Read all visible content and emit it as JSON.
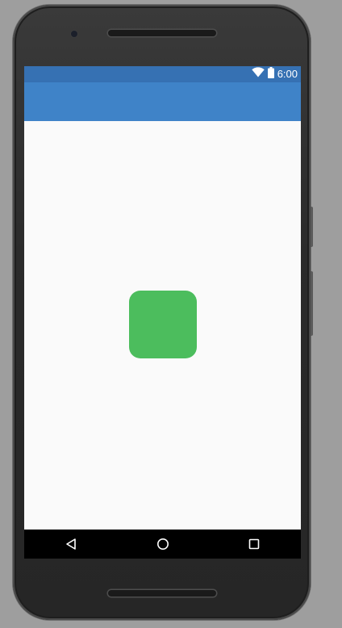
{
  "status_bar": {
    "time": "6:00",
    "icons": [
      "wifi-icon",
      "battery-icon"
    ],
    "color": "#3671b3"
  },
  "app_bar": {
    "color": "#3f83c8"
  },
  "content": {
    "shape": {
      "kind": "rounded-square",
      "color": "#4cbd5d"
    }
  },
  "nav_bar": {
    "buttons": [
      "back-icon",
      "home-icon",
      "recents-icon"
    ]
  }
}
